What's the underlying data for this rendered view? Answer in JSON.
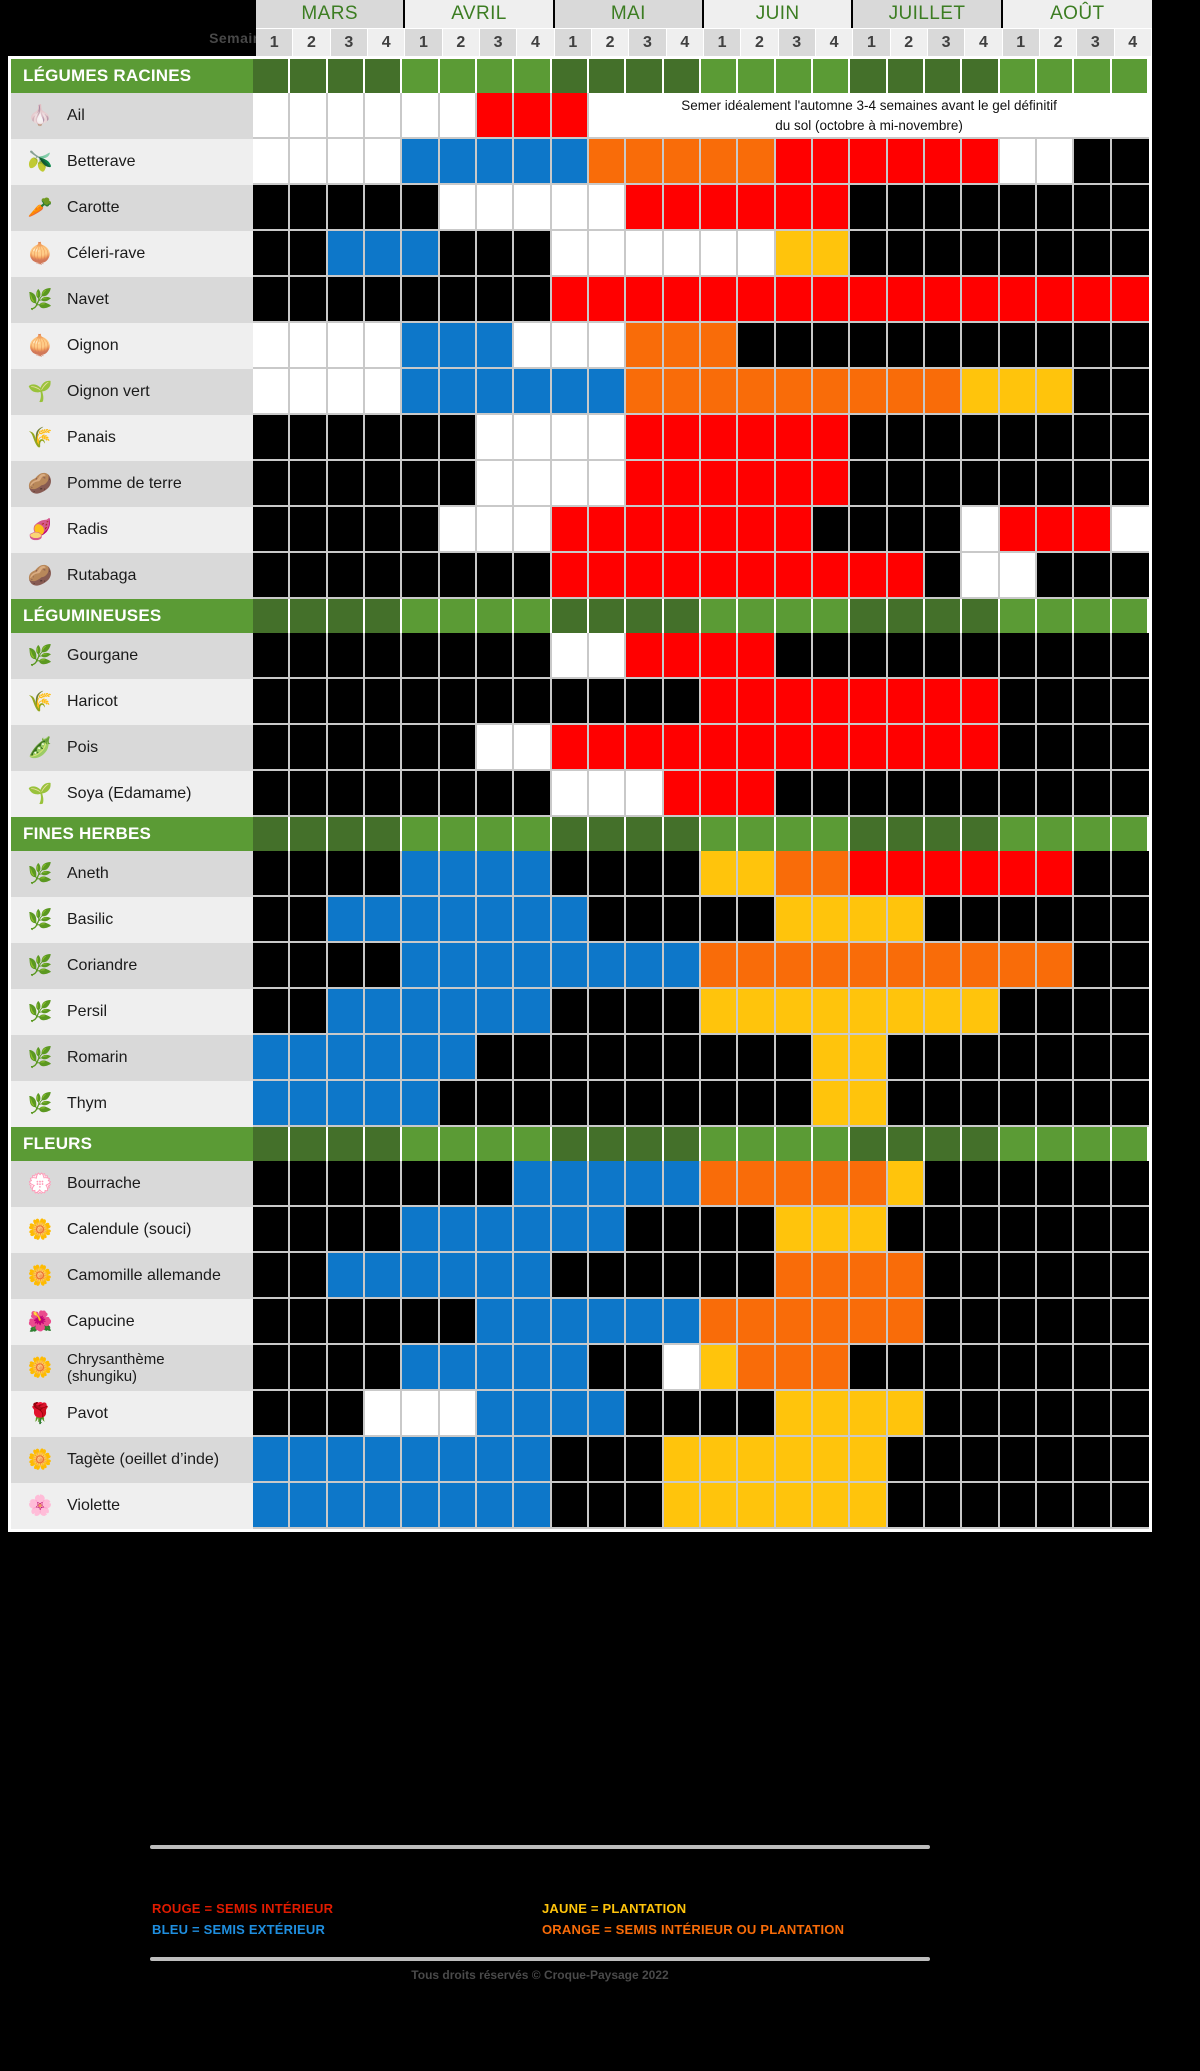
{
  "header": {
    "weeks_label": "Semaines :",
    "months": [
      "MARS",
      "AVRIL",
      "MAI",
      "JUIN",
      "JUILLET",
      "AOÛT"
    ],
    "week_numbers": [
      1,
      2,
      3,
      4
    ]
  },
  "colors": {
    "red": "#ff0000",
    "blue": "#0d77c9",
    "yellow": "#ffc40c",
    "orange": "#f96c09",
    "black": "#000000",
    "white": "#ffffff",
    "green": "#5b9b35",
    "green_dark": "#44702a"
  },
  "legend": {
    "left": [
      {
        "text": "ROUGE = SEMIS INTÉRIEUR",
        "color": "#e01b00"
      },
      {
        "text": "BLEU = SEMIS EXTÉRIEUR",
        "color": "#1f8fe0"
      }
    ],
    "right": [
      {
        "text": "JAUNE = PLANTATION",
        "color": "#ffc40c"
      },
      {
        "text": "ORANGE = SEMIS INTÉRIEUR OU PLANTATION",
        "color": "#f96c09"
      }
    ],
    "copyright": "Tous droits réservés © Croque-Paysage 2022"
  },
  "note": {
    "line1": "Semer idéalement  l'automne 3-4 semaines  avant le gel définitif",
    "line2": "du sol (octobre à mi-novembre)"
  },
  "sections": [
    {
      "title": "LÉGUMES RACINES",
      "rows": [
        {
          "name": "Ail",
          "icon": "garlic-icon",
          "glyph": "🧄",
          "note": true,
          "cells": [
            "w",
            "w",
            "w",
            "w",
            "w",
            "w",
            "r",
            "r",
            "r",
            "note",
            "note",
            "note",
            "note",
            "note",
            "note",
            "note",
            "note",
            "note",
            "note",
            "note",
            "note",
            "note",
            "note",
            "note"
          ]
        },
        {
          "name": "Betterave",
          "icon": "beet-icon",
          "glyph": "🫒",
          "cells": [
            "w",
            "w",
            "w",
            "w",
            "b",
            "b",
            "b",
            "b",
            "b",
            "o",
            "o",
            "o",
            "o",
            "o",
            "r",
            "r",
            "r",
            "r",
            "r",
            "r",
            "w",
            "w",
            "k",
            "k"
          ]
        },
        {
          "name": "Carotte",
          "icon": "carrot-icon",
          "glyph": "🥕",
          "cells": [
            "k",
            "k",
            "k",
            "k",
            "k",
            "w",
            "w",
            "w",
            "w",
            "w",
            "r",
            "r",
            "r",
            "r",
            "r",
            "r",
            "k",
            "k",
            "k",
            "k",
            "k",
            "k",
            "k",
            "k"
          ]
        },
        {
          "name": "Céleri-rave",
          "icon": "celeriac-icon",
          "glyph": "🧅",
          "cells": [
            "k",
            "k",
            "b",
            "b",
            "b",
            "k",
            "k",
            "k",
            "w",
            "w",
            "w",
            "w",
            "w",
            "w",
            "y",
            "y",
            "k",
            "k",
            "k",
            "k",
            "k",
            "k",
            "k",
            "k"
          ]
        },
        {
          "name": "Navet",
          "icon": "turnip-icon",
          "glyph": "🌿",
          "cells": [
            "k",
            "k",
            "k",
            "k",
            "k",
            "k",
            "k",
            "k",
            "r",
            "r",
            "r",
            "r",
            "r",
            "r",
            "r",
            "r",
            "r",
            "r",
            "r",
            "r",
            "r",
            "r",
            "r",
            "r"
          ]
        },
        {
          "name": "Oignon",
          "icon": "onion-icon",
          "glyph": "🧅",
          "cells": [
            "w",
            "w",
            "w",
            "w",
            "b",
            "b",
            "b",
            "w",
            "w",
            "w",
            "o",
            "o",
            "o",
            "k",
            "k",
            "k",
            "k",
            "k",
            "k",
            "k",
            "k",
            "k",
            "k",
            "k"
          ]
        },
        {
          "name": "Oignon vert",
          "icon": "green-onion-icon",
          "glyph": "🌱",
          "cells": [
            "w",
            "w",
            "w",
            "w",
            "b",
            "b",
            "b",
            "b",
            "b",
            "b",
            "o",
            "o",
            "o",
            "o",
            "o",
            "o",
            "o",
            "o",
            "o",
            "y",
            "y",
            "y",
            "k",
            "k"
          ]
        },
        {
          "name": "Panais",
          "icon": "parsnip-icon",
          "glyph": "🌾",
          "cells": [
            "k",
            "k",
            "k",
            "k",
            "k",
            "k",
            "w",
            "w",
            "w",
            "w",
            "r",
            "r",
            "r",
            "r",
            "r",
            "r",
            "k",
            "k",
            "k",
            "k",
            "k",
            "k",
            "k",
            "k"
          ]
        },
        {
          "name": "Pomme de terre",
          "icon": "potato-icon",
          "glyph": "🥔",
          "cells": [
            "k",
            "k",
            "k",
            "k",
            "k",
            "k",
            "w",
            "w",
            "w",
            "w",
            "r",
            "r",
            "r",
            "r",
            "r",
            "r",
            "k",
            "k",
            "k",
            "k",
            "k",
            "k",
            "k",
            "k"
          ]
        },
        {
          "name": "Radis",
          "icon": "radish-icon",
          "glyph": "🍠",
          "cells": [
            "k",
            "k",
            "k",
            "k",
            "k",
            "w",
            "w",
            "w",
            "r",
            "r",
            "r",
            "r",
            "r",
            "r",
            "r",
            "k",
            "k",
            "k",
            "k",
            "w",
            "r",
            "r",
            "r",
            "w"
          ]
        },
        {
          "name": "Rutabaga",
          "icon": "rutabaga-icon",
          "glyph": "🥔",
          "cells": [
            "k",
            "k",
            "k",
            "k",
            "k",
            "k",
            "k",
            "k",
            "r",
            "r",
            "r",
            "r",
            "r",
            "r",
            "r",
            "r",
            "r",
            "r",
            "k",
            "w",
            "w",
            "k",
            "k",
            "k"
          ]
        }
      ]
    },
    {
      "title": "LÉGUMINEUSES",
      "rows": [
        {
          "name": "Gourgane",
          "icon": "broadbean-icon",
          "glyph": "🌿",
          "cells": [
            "k",
            "k",
            "k",
            "k",
            "k",
            "k",
            "k",
            "k",
            "w",
            "w",
            "r",
            "r",
            "r",
            "r",
            "k",
            "k",
            "k",
            "k",
            "k",
            "k",
            "k",
            "k",
            "k",
            "k"
          ]
        },
        {
          "name": "Haricot",
          "icon": "bean-icon",
          "glyph": "🌾",
          "cells": [
            "k",
            "k",
            "k",
            "k",
            "k",
            "k",
            "k",
            "k",
            "k",
            "k",
            "k",
            "k",
            "r",
            "r",
            "r",
            "r",
            "r",
            "r",
            "r",
            "r",
            "k",
            "k",
            "k",
            "k"
          ]
        },
        {
          "name": "Pois",
          "icon": "pea-icon",
          "glyph": "🫛",
          "cells": [
            "k",
            "k",
            "k",
            "k",
            "k",
            "k",
            "w",
            "w",
            "r",
            "r",
            "r",
            "r",
            "r",
            "r",
            "r",
            "r",
            "r",
            "r",
            "r",
            "r",
            "k",
            "k",
            "k",
            "k"
          ]
        },
        {
          "name": "Soya (Edamame)",
          "icon": "soy-icon",
          "glyph": "🌱",
          "cells": [
            "k",
            "k",
            "k",
            "k",
            "k",
            "k",
            "k",
            "k",
            "w",
            "w",
            "w",
            "r",
            "r",
            "r",
            "k",
            "k",
            "k",
            "k",
            "k",
            "k",
            "k",
            "k",
            "k",
            "k"
          ]
        }
      ]
    },
    {
      "title": "FINES HERBES",
      "rows": [
        {
          "name": "Aneth",
          "icon": "dill-icon",
          "glyph": "🌿",
          "cells": [
            "k",
            "k",
            "k",
            "k",
            "b",
            "b",
            "b",
            "b",
            "k",
            "k",
            "k",
            "k",
            "y",
            "y",
            "o",
            "o",
            "r",
            "r",
            "r",
            "r",
            "r",
            "r",
            "k",
            "k"
          ]
        },
        {
          "name": "Basilic",
          "icon": "basil-icon",
          "glyph": "🌿",
          "cells": [
            "k",
            "k",
            "b",
            "b",
            "b",
            "b",
            "b",
            "b",
            "b",
            "k",
            "k",
            "k",
            "k",
            "k",
            "y",
            "y",
            "y",
            "y",
            "k",
            "k",
            "k",
            "k",
            "k",
            "k"
          ]
        },
        {
          "name": "Coriandre",
          "icon": "coriander-icon",
          "glyph": "🌿",
          "cells": [
            "k",
            "k",
            "k",
            "k",
            "b",
            "b",
            "b",
            "b",
            "b",
            "b",
            "b",
            "b",
            "o",
            "o",
            "o",
            "o",
            "o",
            "o",
            "o",
            "o",
            "o",
            "o",
            "k",
            "k"
          ]
        },
        {
          "name": "Persil",
          "icon": "parsley-icon",
          "glyph": "🌿",
          "cells": [
            "k",
            "k",
            "b",
            "b",
            "b",
            "b",
            "b",
            "b",
            "k",
            "k",
            "k",
            "k",
            "y",
            "y",
            "y",
            "y",
            "y",
            "y",
            "y",
            "y",
            "k",
            "k",
            "k",
            "k"
          ]
        },
        {
          "name": "Romarin",
          "icon": "rosemary-icon",
          "glyph": "🌿",
          "cells": [
            "b",
            "b",
            "b",
            "b",
            "b",
            "b",
            "k",
            "k",
            "k",
            "k",
            "k",
            "k",
            "k",
            "k",
            "k",
            "y",
            "y",
            "k",
            "k",
            "k",
            "k",
            "k",
            "k",
            "k"
          ]
        },
        {
          "name": "Thym",
          "icon": "thyme-icon",
          "glyph": "🌿",
          "cells": [
            "b",
            "b",
            "b",
            "b",
            "b",
            "k",
            "k",
            "k",
            "k",
            "k",
            "k",
            "k",
            "k",
            "k",
            "k",
            "y",
            "y",
            "k",
            "k",
            "k",
            "k",
            "k",
            "k",
            "k"
          ]
        }
      ]
    },
    {
      "title": "FLEURS",
      "rows": [
        {
          "name": "Bourrache",
          "icon": "borage-icon",
          "glyph": "💮",
          "cells": [
            "k",
            "k",
            "k",
            "k",
            "k",
            "k",
            "k",
            "b",
            "b",
            "b",
            "b",
            "b",
            "o",
            "o",
            "o",
            "o",
            "o",
            "y",
            "k",
            "k",
            "k",
            "k",
            "k",
            "k"
          ]
        },
        {
          "name": "Calendule (souci)",
          "icon": "calendula-icon",
          "glyph": "🌼",
          "cells": [
            "k",
            "k",
            "k",
            "k",
            "b",
            "b",
            "b",
            "b",
            "b",
            "b",
            "k",
            "k",
            "k",
            "k",
            "y",
            "y",
            "y",
            "k",
            "k",
            "k",
            "k",
            "k",
            "k",
            "k"
          ]
        },
        {
          "name": "Camomille allemande",
          "icon": "chamomile-icon",
          "glyph": "🌼",
          "cells": [
            "k",
            "k",
            "b",
            "b",
            "b",
            "b",
            "b",
            "b",
            "k",
            "k",
            "k",
            "k",
            "k",
            "k",
            "o",
            "o",
            "o",
            "o",
            "k",
            "k",
            "k",
            "k",
            "k",
            "k"
          ]
        },
        {
          "name": "Capucine",
          "icon": "nasturtium-icon",
          "glyph": "🌺",
          "cells": [
            "k",
            "k",
            "k",
            "k",
            "k",
            "k",
            "b",
            "b",
            "b",
            "b",
            "b",
            "b",
            "o",
            "o",
            "o",
            "o",
            "o",
            "o",
            "k",
            "k",
            "k",
            "k",
            "k",
            "k"
          ]
        },
        {
          "name": "Chrysanthème (shungiku)",
          "icon": "chrysanthemum-icon",
          "glyph": "🌼",
          "two_line": true,
          "name_line1": "Chrysanthème",
          "name_line2": "(shungiku)",
          "cells": [
            "k",
            "k",
            "k",
            "k",
            "b",
            "b",
            "b",
            "b",
            "b",
            "k",
            "k",
            "w",
            "y",
            "o",
            "o",
            "o",
            "k",
            "k",
            "k",
            "k",
            "k",
            "k",
            "k",
            "k"
          ]
        },
        {
          "name": "Pavot",
          "icon": "poppy-icon",
          "glyph": "🌹",
          "cells": [
            "k",
            "k",
            "k",
            "w",
            "w",
            "w",
            "b",
            "b",
            "b",
            "b",
            "k",
            "k",
            "k",
            "k",
            "y",
            "y",
            "y",
            "y",
            "k",
            "k",
            "k",
            "k",
            "k",
            "k"
          ]
        },
        {
          "name": "Tagète (oeillet d’inde)",
          "icon": "marigold-icon",
          "glyph": "🌼",
          "cells": [
            "b",
            "b",
            "b",
            "b",
            "b",
            "b",
            "b",
            "b",
            "k",
            "k",
            "k",
            "y",
            "y",
            "y",
            "y",
            "y",
            "y",
            "k",
            "k",
            "k",
            "k",
            "k",
            "k",
            "k"
          ]
        },
        {
          "name": "Violette",
          "icon": "violet-icon",
          "glyph": "🌸",
          "cells": [
            "b",
            "b",
            "b",
            "b",
            "b",
            "b",
            "b",
            "b",
            "k",
            "k",
            "k",
            "y",
            "y",
            "y",
            "y",
            "y",
            "y",
            "k",
            "k",
            "k",
            "k",
            "k",
            "k",
            "k"
          ]
        }
      ]
    }
  ]
}
